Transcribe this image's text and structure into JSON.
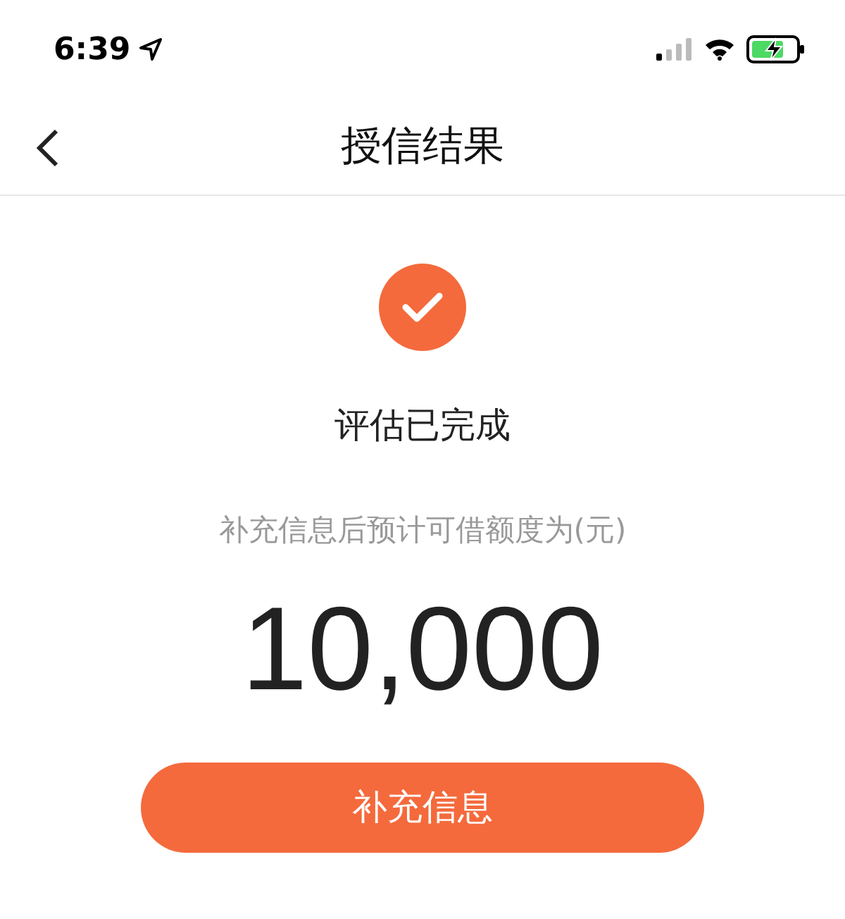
{
  "status_bar": {
    "time": "6:39"
  },
  "nav": {
    "title": "授信结果"
  },
  "result": {
    "status": "评估已完成",
    "subtitle": "补充信息后预计可借额度为(元)",
    "amount": "10,000"
  },
  "button": {
    "label": "补充信息"
  }
}
